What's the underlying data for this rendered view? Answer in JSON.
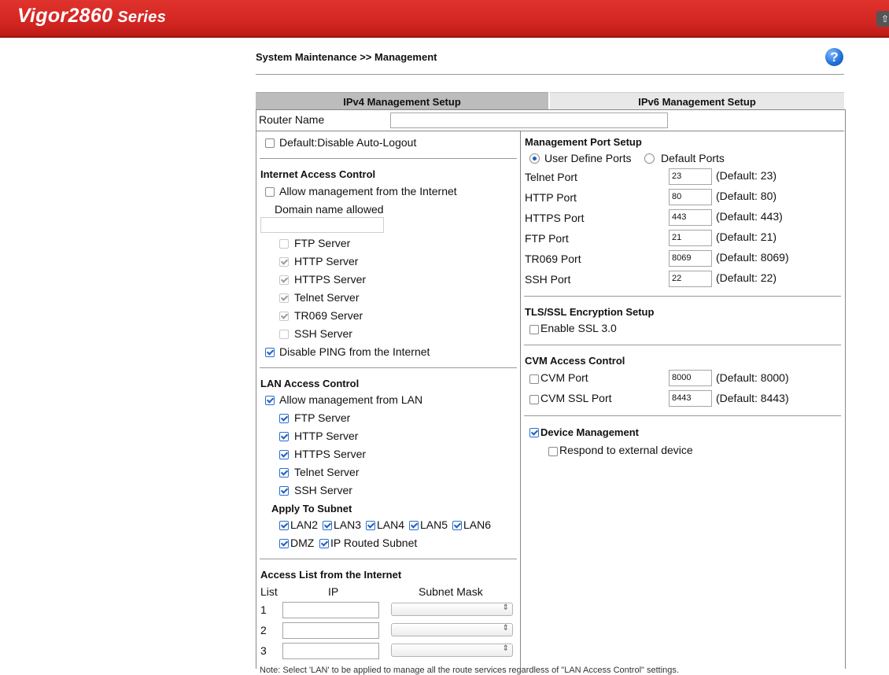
{
  "header": {
    "brand": "Vigor2860",
    "series": "Series"
  },
  "breadcrumb": "System Maintenance >> Management",
  "tabs": [
    "IPv4 Management Setup",
    "IPv6 Management Setup"
  ],
  "router_name": {
    "label": "Router Name",
    "value": ""
  },
  "left": {
    "auto_logout": {
      "label": "Default:Disable Auto-Logout",
      "checked": false
    },
    "internet_access": {
      "title": "Internet Access Control",
      "allow": {
        "label": "Allow management from the Internet",
        "checked": false
      },
      "domain_label": "Domain name allowed",
      "domain_value": "",
      "servers": [
        {
          "label": "FTP Server",
          "checked": false
        },
        {
          "label": "HTTP Server",
          "checked": true
        },
        {
          "label": "HTTPS Server",
          "checked": true
        },
        {
          "label": "Telnet Server",
          "checked": true
        },
        {
          "label": "TR069 Server",
          "checked": true
        },
        {
          "label": "SSH Server",
          "checked": false
        }
      ],
      "disable_ping": {
        "label": "Disable PING from the Internet",
        "checked": true
      }
    },
    "lan_access": {
      "title": "LAN Access Control",
      "allow": {
        "label": "Allow management from LAN",
        "checked": true
      },
      "servers": [
        {
          "label": "FTP Server",
          "checked": true
        },
        {
          "label": "HTTP Server",
          "checked": true
        },
        {
          "label": "HTTPS Server",
          "checked": true
        },
        {
          "label": "Telnet Server",
          "checked": true
        },
        {
          "label": "SSH Server",
          "checked": true
        }
      ],
      "apply_title": "Apply To Subnet",
      "subnets_row1": [
        "LAN2",
        "LAN3",
        "LAN4",
        "LAN5",
        "LAN6"
      ],
      "subnets_row2": [
        "DMZ",
        "IP Routed Subnet"
      ]
    },
    "access_list": {
      "title": "Access List from the Internet",
      "col_list": "List",
      "col_ip": "IP",
      "col_mask": "Subnet Mask",
      "rows": [
        "1",
        "2",
        "3"
      ]
    }
  },
  "right": {
    "mgmt_port": {
      "title": "Management Port Setup",
      "user_define": "User Define Ports",
      "default_ports": "Default Ports",
      "selected": "User Define Ports",
      "ports": [
        {
          "label": "Telnet Port",
          "value": "23",
          "default": "(Default: 23)"
        },
        {
          "label": "HTTP Port",
          "value": "80",
          "default": "(Default: 80)"
        },
        {
          "label": "HTTPS Port",
          "value": "443",
          "default": "(Default: 443)"
        },
        {
          "label": "FTP Port",
          "value": "21",
          "default": "(Default: 21)"
        },
        {
          "label": "TR069 Port",
          "value": "8069",
          "default": "(Default: 8069)"
        },
        {
          "label": "SSH Port",
          "value": "22",
          "default": "(Default: 22)"
        }
      ]
    },
    "tls": {
      "title": "TLS/SSL Encryption Setup",
      "ssl3": {
        "label": "Enable SSL 3.0",
        "checked": false
      }
    },
    "cvm": {
      "title": "CVM Access Control",
      "ports": [
        {
          "label": "CVM Port",
          "value": "8000",
          "default": "(Default: 8000)",
          "checked": false
        },
        {
          "label": "CVM SSL Port",
          "value": "8443",
          "default": "(Default: 8443)",
          "checked": false
        }
      ]
    },
    "device_mgmt": {
      "label": "Device Management",
      "checked": true,
      "respond": {
        "label": "Respond to external device",
        "checked": false
      }
    }
  },
  "note": "Note: Select 'LAN' to be applied to manage all the route services regardless of \"LAN Access Control\" settings."
}
